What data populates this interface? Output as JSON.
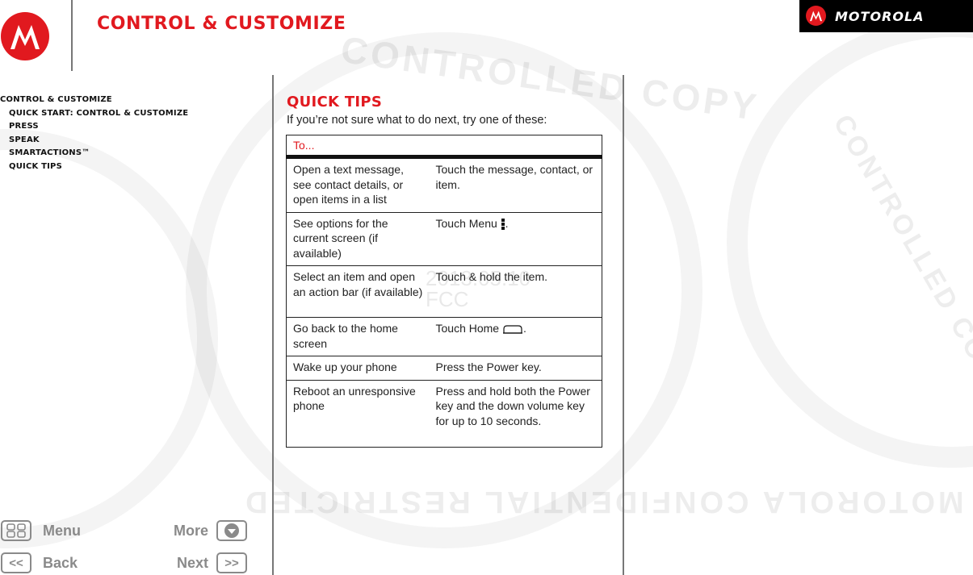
{
  "header": {
    "page_title": "CONTROL & CUSTOMIZE",
    "brand_name": "MOTOROLA",
    "logo_icon": "motorola-m-logo-icon"
  },
  "toc": {
    "items": [
      {
        "label": "CONTROL & CUSTOMIZE",
        "level": 0
      },
      {
        "label": "QUICK START: CONTROL & CUSTOMIZE",
        "level": 1
      },
      {
        "label": "PRESS",
        "level": 1
      },
      {
        "label": "SPEAK",
        "level": 1
      },
      {
        "label": "SMARTACTIONS™",
        "level": 1
      },
      {
        "label": "QUICK TIPS",
        "level": 1
      }
    ]
  },
  "nav": {
    "menu_label": "Menu",
    "more_label": "More",
    "back_label": "Back",
    "next_label": "Next",
    "back_glyph": "<<",
    "next_glyph": ">>"
  },
  "main": {
    "section_title": "QUICK TIPS",
    "intro": "If you’re not sure what to do next, try one of these:",
    "table": {
      "header": "To...",
      "rows": [
        {
          "task": "Open a text message, see contact details, or open items in a list",
          "action": "Touch the message, contact, or item."
        },
        {
          "task": "See options for the current screen (if available)",
          "action": "Touch Menu",
          "action_icon": "menu-dots-icon",
          "action_suffix": "."
        },
        {
          "task": "Select an item and open an action bar (if available)",
          "action": "Touch & hold the item."
        },
        {
          "task": "Go back to the home screen",
          "action": "Touch Home",
          "action_icon": "home-icon",
          "action_suffix": "."
        },
        {
          "task": "Wake up your phone",
          "action": "Press the Power key."
        },
        {
          "task": "Reboot an unresponsive phone",
          "action": "Press and hold both the Power key and the down volume key for up to 10 seconds."
        }
      ]
    }
  },
  "watermark": {
    "texts": [
      "CONTROLLED COPY",
      "MOTOROLA CONFIDENTIAL RESTRICTED",
      "Confidential"
    ],
    "stamp_date": "2013.05.10",
    "stamp_label": "FCC"
  },
  "colors": {
    "accent": "#e1191f",
    "nav_gray": "#8a8a8a",
    "brand_bar": "#000000"
  }
}
